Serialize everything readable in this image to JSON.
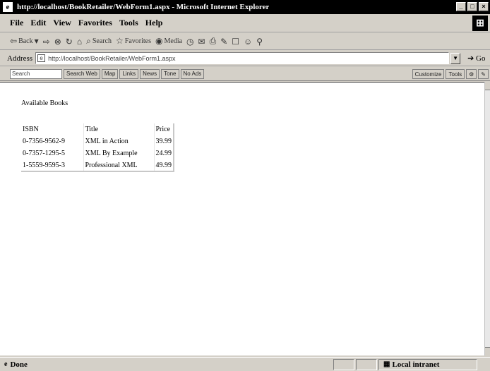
{
  "window": {
    "title": "http://localhost/BookRetailer/WebForm1.aspx - Microsoft Internet Explorer",
    "logo": "e",
    "controls": [
      "_",
      "□",
      "×"
    ]
  },
  "menu": {
    "items": [
      "File",
      "Edit",
      "View",
      "Favorites",
      "Tools",
      "Help"
    ]
  },
  "toolbar": {
    "back": "Back",
    "search": "Search",
    "favorites": "Favorites",
    "media": "Media"
  },
  "address": {
    "label": "Address",
    "url": "http://localhost/BookRetailer/WebForm1.aspx",
    "go": "Go"
  },
  "linkbar": {
    "search_placeholder": "Search",
    "buttons": [
      "Search Web",
      "Map",
      "Links",
      "News",
      "Tone",
      "No Ads"
    ],
    "right_buttons": [
      "Customize",
      "Tools"
    ]
  },
  "page": {
    "heading": "Available Books",
    "table": {
      "headers": [
        "ISBN",
        "Title",
        "Price"
      ],
      "rows": [
        [
          "0-7356-9562-9",
          "XML in Action",
          "39.99"
        ],
        [
          "0-7357-1295-5",
          "XML By Example",
          "24.99"
        ],
        [
          "1-5559-9595-3",
          "Professional XML",
          "49.99"
        ]
      ]
    }
  },
  "status": {
    "left": "Done",
    "zone": "Local intranet"
  }
}
